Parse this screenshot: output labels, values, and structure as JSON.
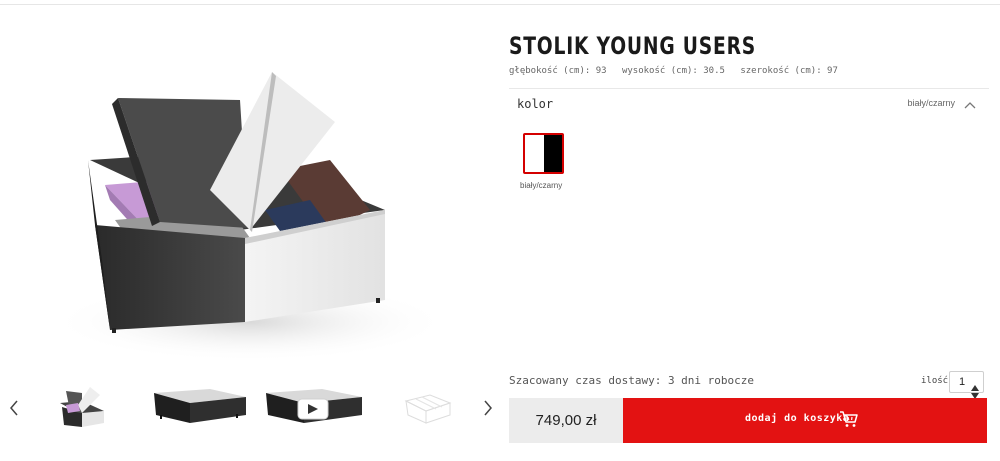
{
  "product": {
    "title": "STOLIK YOUNG USERS",
    "dimensions": [
      "głębokość (cm): 93",
      "wysokość (cm): 30.5",
      "szerokość (cm): 97"
    ]
  },
  "color_section": {
    "label": "kolor",
    "selected_value": "biały/czarny",
    "swatches": [
      {
        "label": "biały/czarny",
        "colors": [
          "#ffffff",
          "#000000"
        ],
        "border": "#d40000"
      }
    ]
  },
  "delivery": {
    "text": "Szacowany czas dostawy: 3 dni robocze"
  },
  "quantity": {
    "label": "ilość",
    "value": "1"
  },
  "purchase": {
    "price": "749,00 zł",
    "add_to_cart_label": "dodaj do koszyka",
    "accent_color": "#e31212"
  },
  "gallery": {
    "thumbnails": [
      "thumbnail-open-table",
      "thumbnail-closed-table",
      "thumbnail-video",
      "thumbnail-drawing"
    ]
  }
}
